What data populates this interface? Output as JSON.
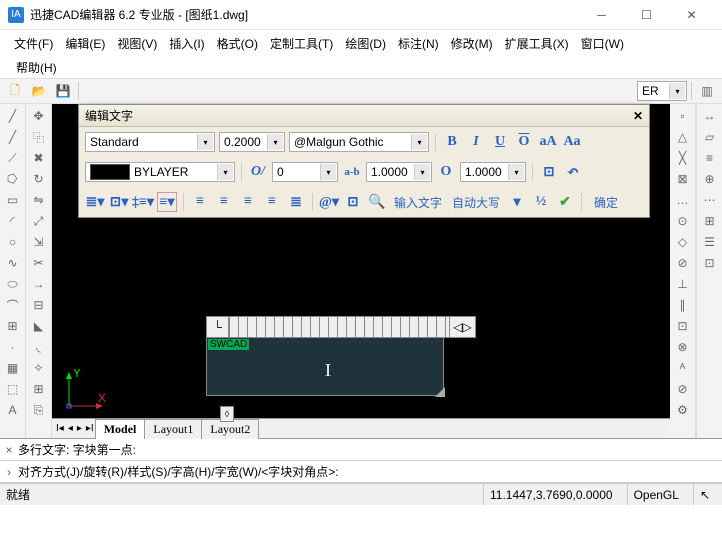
{
  "titlebar": {
    "app": "迅捷CAD编辑器 6.2 专业版  - [图纸1.dwg]"
  },
  "menu": {
    "file": "文件(F)",
    "edit": "编辑(E)",
    "view": "视图(V)",
    "insert": "插入(I)",
    "format": "格式(O)",
    "custom": "定制工具(T)",
    "draw": "绘图(D)",
    "dim": "标注(N)",
    "modify": "修改(M)",
    "ext": "扩展工具(X)",
    "window": "窗口(W)",
    "help": "帮助(H)"
  },
  "dialog": {
    "title": "编辑文字",
    "style": "Standard",
    "height": "0.2000",
    "font": "@Malgun Gothic",
    "formats": {
      "B": "B",
      "I": "I",
      "U": "U",
      "O": "O",
      "aA": "aA",
      "Aa": "Aa"
    },
    "layer": "BYLAYER",
    "oblique": "O/",
    "oblique_val": "0",
    "track": "a-b",
    "track_val": "1.0000",
    "width_icon": "O",
    "width_val": "1.0000",
    "row3": {
      "input_text": "输入文字",
      "autocaps": "自动大写",
      "ok": "确定"
    }
  },
  "mtext": {
    "sample": "SWCAD"
  },
  "layouts": {
    "model": "Model",
    "l1": "Layout1",
    "l2": "Layout2"
  },
  "cmd": {
    "line1": "多行文字: 字块第一点:",
    "line2": "对齐方式(J)/旋转(R)/样式(S)/字高(H)/字宽(W)/<字块对角点>:"
  },
  "status": {
    "ready": "就绪",
    "coords": "11.1447,3.7690,0.0000",
    "render": "OpenGL"
  }
}
